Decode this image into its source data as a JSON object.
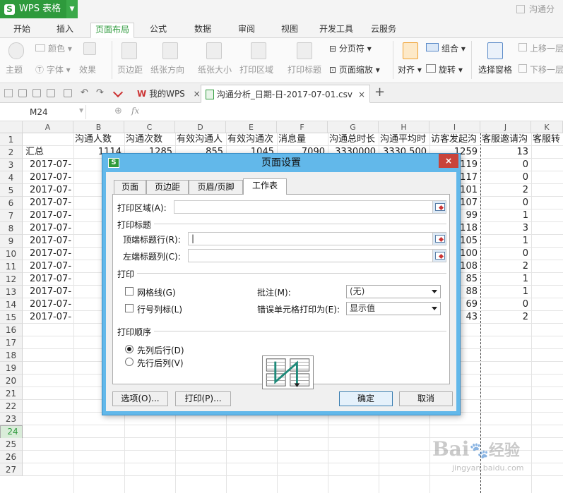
{
  "app": {
    "name": "WPS 表格",
    "logo_letter": "S",
    "window_title": "沟通分"
  },
  "menu": [
    "开始",
    "插入",
    "页面布局",
    "公式",
    "数据",
    "审阅",
    "视图",
    "开发工具",
    "云服务"
  ],
  "ribbon": {
    "row1": [
      "颜色",
      "分页符",
      "组合",
      "上移一层"
    ],
    "row2": [
      "主题",
      "字体",
      "效果",
      "页边距",
      "纸张方向",
      "纸张大小",
      "打印区域",
      "打印标题",
      "页面缩放",
      "对齐",
      "旋转",
      "选择窗格",
      "下移一层"
    ]
  },
  "tabs": {
    "home": "我的WPS",
    "doc": "沟通分析_日期-日-2017-07-01.csv",
    "add": "+"
  },
  "formula": {
    "cell_ref": "M24",
    "fx": "fx"
  },
  "columns": [
    "A",
    "B",
    "C",
    "D",
    "E",
    "F",
    "G",
    "H",
    "I",
    "J",
    "K"
  ],
  "headers": [
    "",
    "沟通人数",
    "沟通次数",
    "有效沟通人",
    "有效沟通次",
    "消息量",
    "沟通总时长",
    "沟通平均时",
    "访客发起沟",
    "客服邀请沟",
    "客服转"
  ],
  "row2": {
    "label": "汇总",
    "b": "1114",
    "c": "1285",
    "d": "855",
    "e": "1045",
    "f": "7090",
    "g": "3330000",
    "h": "3330.500",
    "i": "1259",
    "j": "13"
  },
  "dates": [
    "2017-07-",
    "2017-07-",
    "2017-07-",
    "2017-07-",
    "2017-07-",
    "2017-07-",
    "2017-07-",
    "2017-07-",
    "2017-07-",
    "2017-07-",
    "2017-07-",
    "2017-07-",
    "2017-07-"
  ],
  "col_i": [
    "119",
    "117",
    "101",
    "107",
    "99",
    "118",
    "105",
    "100",
    "108",
    "85",
    "88",
    "69",
    "43"
  ],
  "col_j": [
    "0",
    "0",
    "2",
    "0",
    "1",
    "3",
    "1",
    "0",
    "2",
    "1",
    "1",
    "0",
    "2"
  ],
  "row_numbers": [
    "1",
    "2",
    "3",
    "4",
    "5",
    "6",
    "7",
    "8",
    "9",
    "10",
    "11",
    "12",
    "13",
    "14",
    "15",
    "16",
    "17",
    "18",
    "19",
    "20",
    "21",
    "22",
    "23",
    "24",
    "25",
    "26",
    "27"
  ],
  "dialog": {
    "title": "页面设置",
    "close": "×",
    "icon": "S",
    "tabs": [
      "页面",
      "页边距",
      "页眉/页脚",
      "工作表"
    ],
    "print_area_label": "打印区域(A):",
    "print_titles_group": "打印标题",
    "top_rows_label": "顶端标题行(R):",
    "left_cols_label": "左端标题列(C):",
    "print_group": "打印",
    "gridlines_label": "网格线(G)",
    "rowcol_label": "行号列标(L)",
    "comments_label": "批注(M):",
    "comments_value": "(无)",
    "errors_label": "错误单元格打印为(E):",
    "errors_value": "显示值",
    "order_group": "打印顺序",
    "order_down": "先列后行(D)",
    "order_over": "先行后列(V)",
    "options_btn": "选项(O)...",
    "print_btn": "打印(P)...",
    "ok_btn": "确定",
    "cancel_btn": "取消"
  },
  "colors": {
    "brand": "#2e9a3c",
    "dialog_frame": "#62b8ea",
    "close": "#c9433a",
    "arrow": "#e8362b"
  },
  "watermark": {
    "brand": "Bai",
    "brand2": "经验",
    "url": "jingyan.baidu.com"
  }
}
